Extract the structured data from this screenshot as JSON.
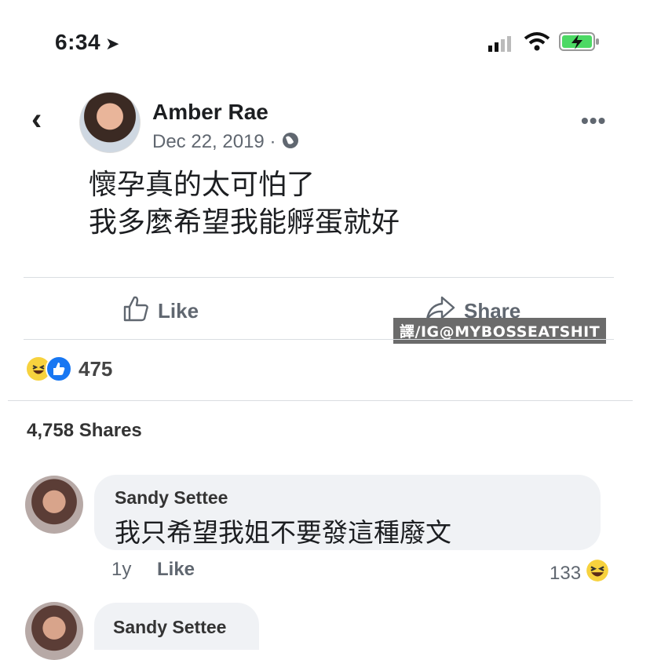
{
  "status_bar": {
    "time": "6:34",
    "battery_charging": true
  },
  "post": {
    "author": "Amber Rae",
    "date": "Dec 22, 2019",
    "date_separator": " · ",
    "privacy_icon": "globe-icon",
    "text_lines": [
      "懷孕真的太可怕了",
      "我多麼希望我能孵蛋就好"
    ],
    "more_label": "•••"
  },
  "actions": {
    "like_label": "Like",
    "share_label": "Share"
  },
  "watermark": "譯/IG@MYBOSSEATSHIT",
  "reactions": {
    "count": "475",
    "icons": [
      "haha-icon",
      "like-icon"
    ]
  },
  "shares_text": "4,758 Shares",
  "comments": [
    {
      "name": "Sandy Settee",
      "text": "我只希望我姐不要發這種廢文",
      "age": "1y",
      "like_label": "Like",
      "reaction_count": "133",
      "reaction_icon": "haha-icon"
    },
    {
      "name": "Sandy Settee"
    }
  ],
  "colors": {
    "meta_gray": "#606770",
    "divider": "#dadde1",
    "bubble": "#f0f2f5",
    "like_blue": "#1877f2",
    "haha_yellow": "#f7d23e"
  }
}
